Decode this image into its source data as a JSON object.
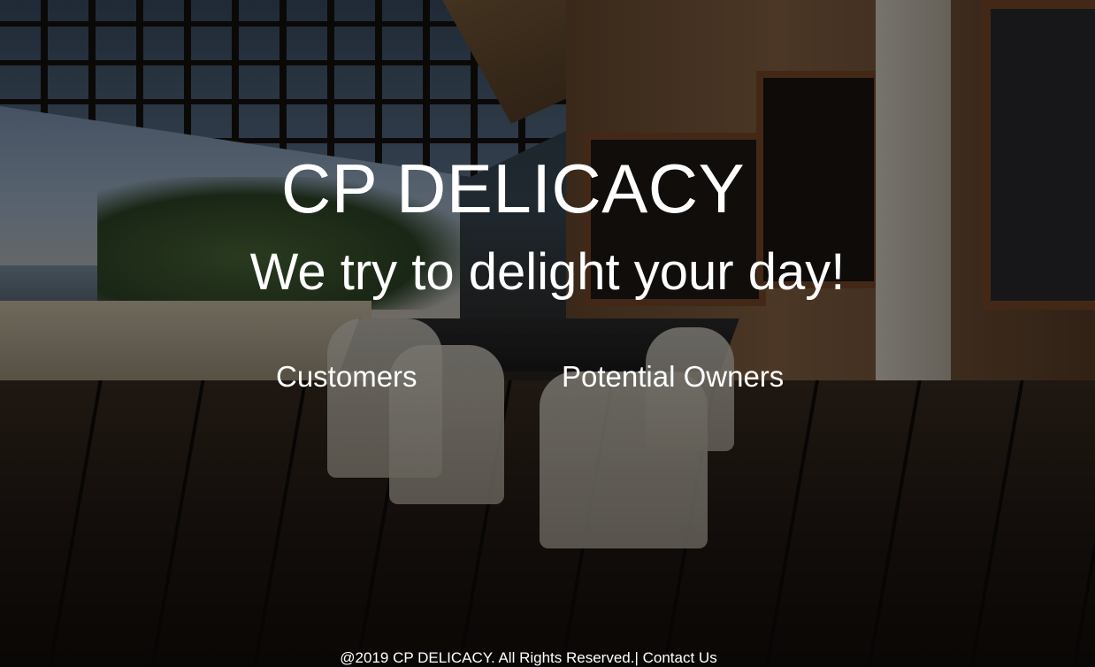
{
  "hero": {
    "title": "CP DELICACY",
    "tagline": "We try to delight your day!"
  },
  "nav": {
    "customers_label": "Customers",
    "owners_label": "Potential Owners"
  },
  "footer": {
    "copyright": "@2019 CP DELICACY. All Rights Reserved.",
    "separator": "|",
    "contact_label": " Contact Us"
  },
  "colors": {
    "text": "#ffffff",
    "overlay": "#000000"
  }
}
